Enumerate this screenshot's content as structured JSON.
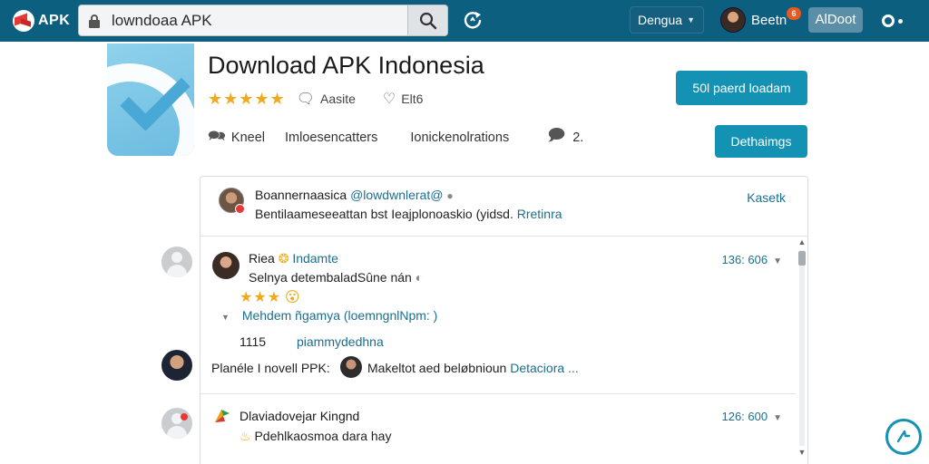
{
  "topbar": {
    "logo_text": "APK",
    "search_value": "lowndoaa APK",
    "language": "Dengua",
    "user_name": "Beetn",
    "notification_count": "6",
    "about_label": "AlDoot"
  },
  "app": {
    "title": "Download APK Indonesia",
    "stars": "★★★★★",
    "stat1": "Aasite",
    "stat2": "Elt6",
    "meta1": "Kneel",
    "meta2": "Imloesencatters",
    "meta3": "Ionickenolrations",
    "meta4": "2.",
    "primary_button": "50l paerd loadam",
    "secondary_button": "Dethaimgs"
  },
  "pinned": {
    "name": "Boannernaasica",
    "handle": "@lowdwnlerat@",
    "text": "Bentilaameseeattan bst  Ieajplonoaskio (yidsd.",
    "link": "Rretinra",
    "action": "Kasetk"
  },
  "comments": [
    {
      "name": "Riea",
      "tag": "Indamte",
      "time": "136: 606",
      "text": "Selnya detembaladSûne nán",
      "stars": "★★★",
      "reply": "Mehdem ñgamya (loemngnlNpm: )",
      "count": "1115",
      "link": "piammydedhna"
    },
    {
      "name": "Dlaviadovejar Kingnd",
      "time": "126: 600",
      "text": "Pdehlkaosmoa dara hay"
    }
  ],
  "mention": {
    "label": "Planéle I novell PPK:",
    "text": "Makeltot aed",
    "text2": "beløbnioun",
    "link": "Detaciora ..."
  },
  "colors": {
    "topbar": "#0d5f80",
    "accent": "#1492b4",
    "link": "#1a6f8f",
    "star": "#f0a81c"
  }
}
